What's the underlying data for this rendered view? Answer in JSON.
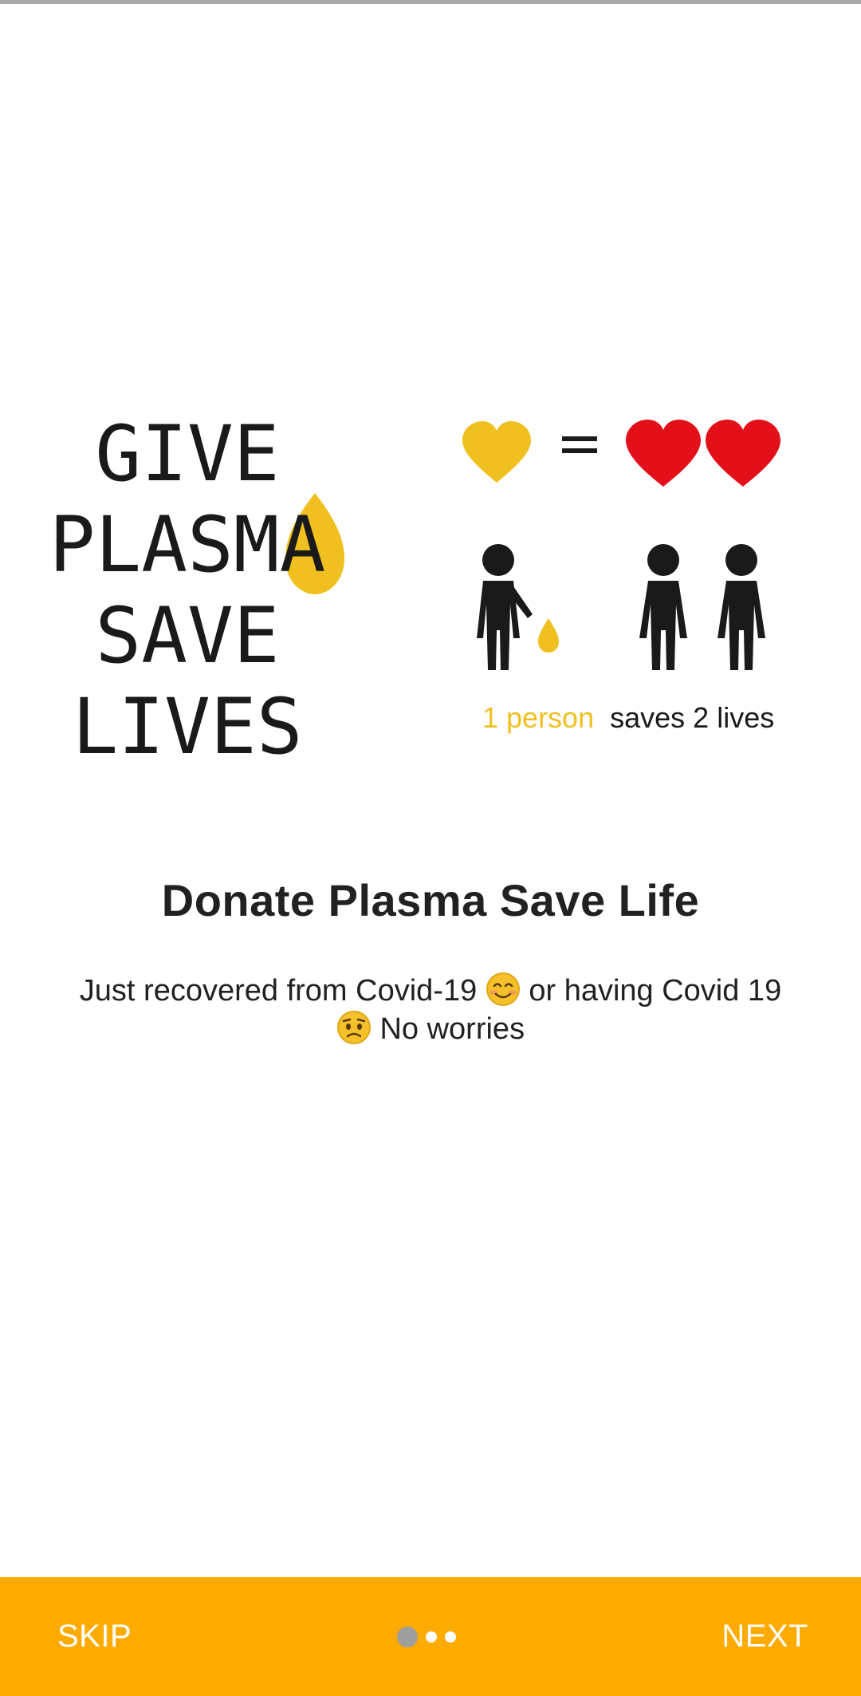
{
  "illustration": {
    "left_text": [
      "GIVE",
      "PLASMA",
      "SAVE",
      "LIVES"
    ],
    "caption_highlight": "1 person",
    "caption_rest": "saves 2 lives",
    "colors": {
      "yellow": "#f0c020",
      "red": "#e3101a",
      "dark": "#1a1a1a"
    }
  },
  "slide": {
    "title": "Donate Plasma Save Life",
    "description_part1": "Just recovered from Covid-19",
    "description_part2": "or having Covid 19",
    "description_part3": "No worries",
    "emoji_1": "smiling-face-icon",
    "emoji_2": "worried-face-icon"
  },
  "bottom_bar": {
    "skip_label": "SKIP",
    "next_label": "NEXT",
    "page_count": 3,
    "active_page": 1,
    "accent_color": "#fdab00"
  }
}
